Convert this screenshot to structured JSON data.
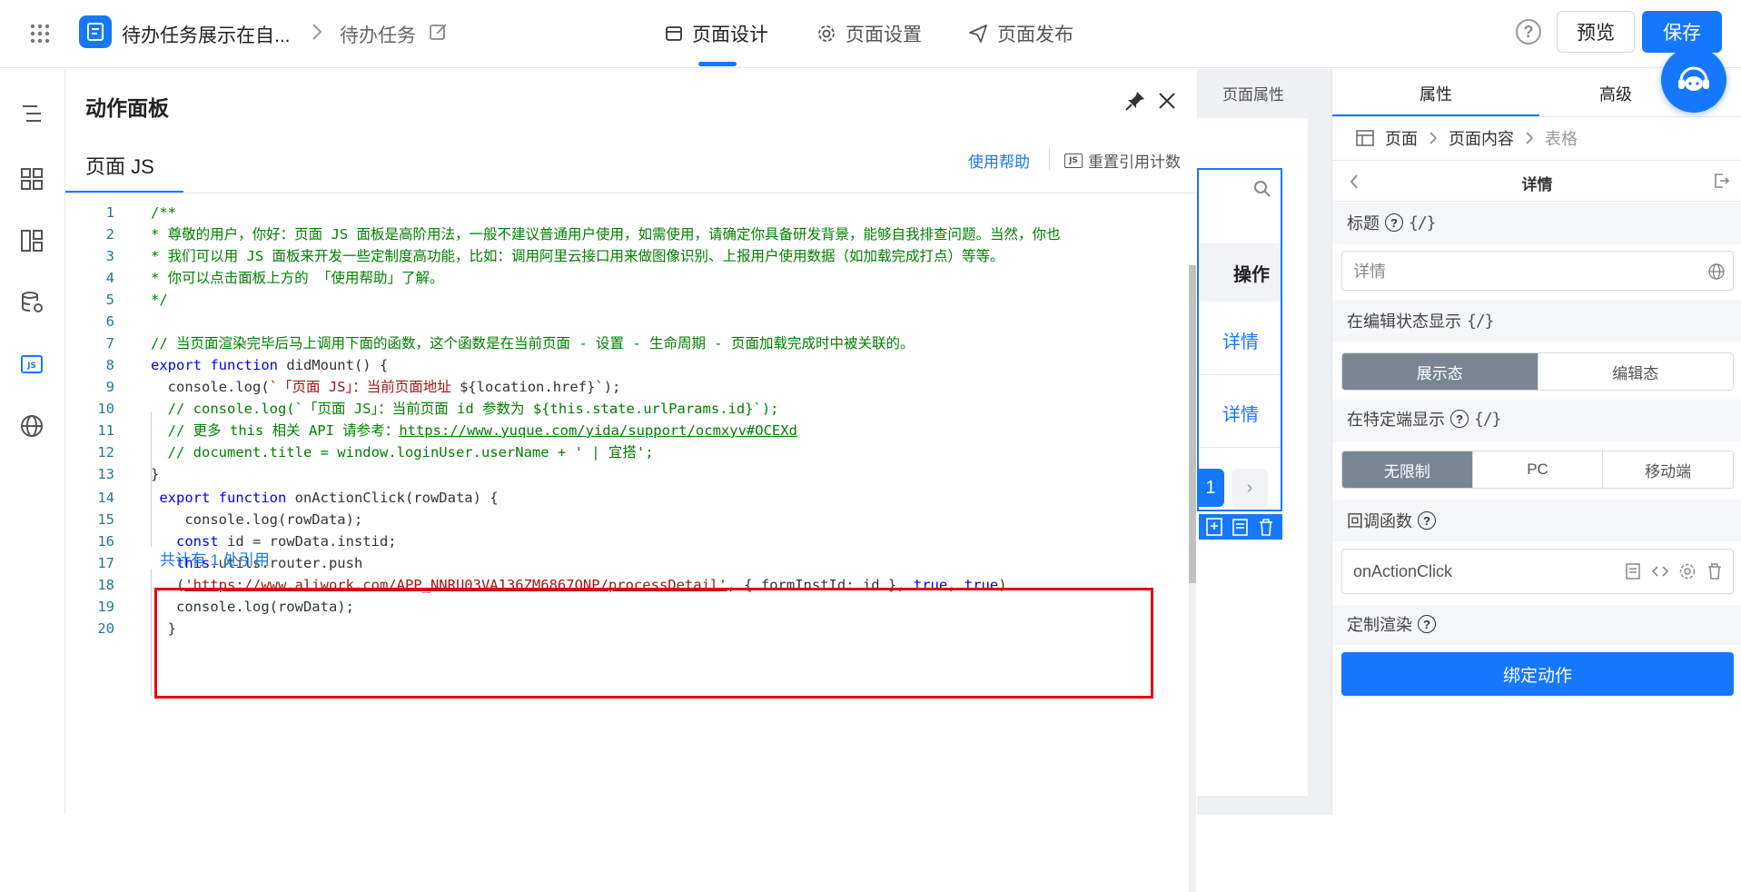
{
  "topbar": {
    "app_title": "待办任务展示在自...",
    "page_name": "待办任务",
    "tabs": [
      {
        "label": "页面设计"
      },
      {
        "label": "页面设置"
      },
      {
        "label": "页面发布"
      }
    ],
    "help": "?",
    "preview_label": "预览",
    "save_label": "保存"
  },
  "panel": {
    "title": "动作面板",
    "tab": "页面 JS",
    "help_link": "使用帮助",
    "reset_label": "重置引用计数",
    "js_badge": "JS",
    "refs_label": "共计有 1 处引用"
  },
  "code_lines": [
    {
      "n": "1",
      "text": "/**"
    },
    {
      "n": "2",
      "text": "* 尊敬的用户，你好：页面 JS 面板是高阶用法，一般不建议普通用户使用，如需使用，请确定你具备研发背景，能够自我排查问题。当然，你也"
    },
    {
      "n": "3",
      "text": "* 我们可以用 JS 面板来开发一些定制度高功能，比如：调用阿里云接口用来做图像识别、上报用户使用数据（如加载完成打点）等等。"
    },
    {
      "n": "4",
      "text": "* 你可以点击面板上方的 「使用帮助」了解。"
    },
    {
      "n": "5",
      "text": "*/"
    },
    {
      "n": "6",
      "text": ""
    },
    {
      "n": "7",
      "text": "// 当页面渲染完毕后马上调用下面的函数，这个函数是在当前页面 - 设置 - 生命周期 - 页面加载完成时中被关联的。"
    },
    {
      "n": "8",
      "kw": "export function",
      "text": " didMount() {"
    },
    {
      "n": "9",
      "text": "  console.log(",
      "str": "`「页面 JS」：当前页面地址",
      "tail": " ${location.href}`);"
    },
    {
      "n": "10",
      "text": "  // console.log(`「页面 JS」：当前页面 id 参数为 ${this.state.urlParams.id}`);"
    },
    {
      "n": "11",
      "text": "  // 更多 this 相关 API 请参考：",
      "link": "https://www.yuque.com/yida/support/ocmxyv#OCEXd"
    },
    {
      "n": "12",
      "text": "  // document.title = window.loginUser.userName + ' | 宜搭';"
    },
    {
      "n": "13",
      "text": "}"
    },
    {
      "n": "14",
      "kw": " export function",
      "text": " onActionClick(rowData) {"
    },
    {
      "n": "15",
      "text": "    console.log(rowData);"
    },
    {
      "n": "16",
      "kw": "   const",
      "text": " id = rowData.instid;"
    },
    {
      "n": "17",
      "kw": "   this",
      "text": ".utils.router.push"
    },
    {
      "n": "18",
      "text": "   (",
      "str": "'https://www.aliwork.com/APP_NNRU03VA136ZM6867ONP/processDetail'",
      "tail": ", { formInstId: id }, ",
      "kw2": "true",
      "tail2": ", ",
      "kw3": "true",
      "tail3": ")"
    },
    {
      "n": "19",
      "text": "   console.log(rowData);"
    },
    {
      "n": "20",
      "text": "  }"
    }
  ],
  "canvas": {
    "page_prop_tab": "页面属性",
    "op_header": "操作",
    "detail_1": "详情",
    "detail_2": "详情",
    "page_current": "1",
    "page_next": "›"
  },
  "props": {
    "tab_attr": "属性",
    "tab_adv": "高级",
    "crumb": [
      "页面",
      "页面内容",
      "表格"
    ],
    "detail_title": "详情",
    "title_label": "标题",
    "title_value": "详情",
    "edit_show_label": "在编辑状态显示",
    "edit_opts": [
      "展示态",
      "编辑态"
    ],
    "terminal_label": "在特定端显示",
    "terminal_opts": [
      "无限制",
      "PC",
      "移动端"
    ],
    "callback_label": "回调函数",
    "callback_value": "onActionClick",
    "render_label": "定制渲染",
    "bind_btn": "绑定动作",
    "var_icon": "{/}"
  },
  "colors": {
    "accent": "#1677ff",
    "highlight": "#e60012",
    "segment_on": "#7a8594"
  }
}
